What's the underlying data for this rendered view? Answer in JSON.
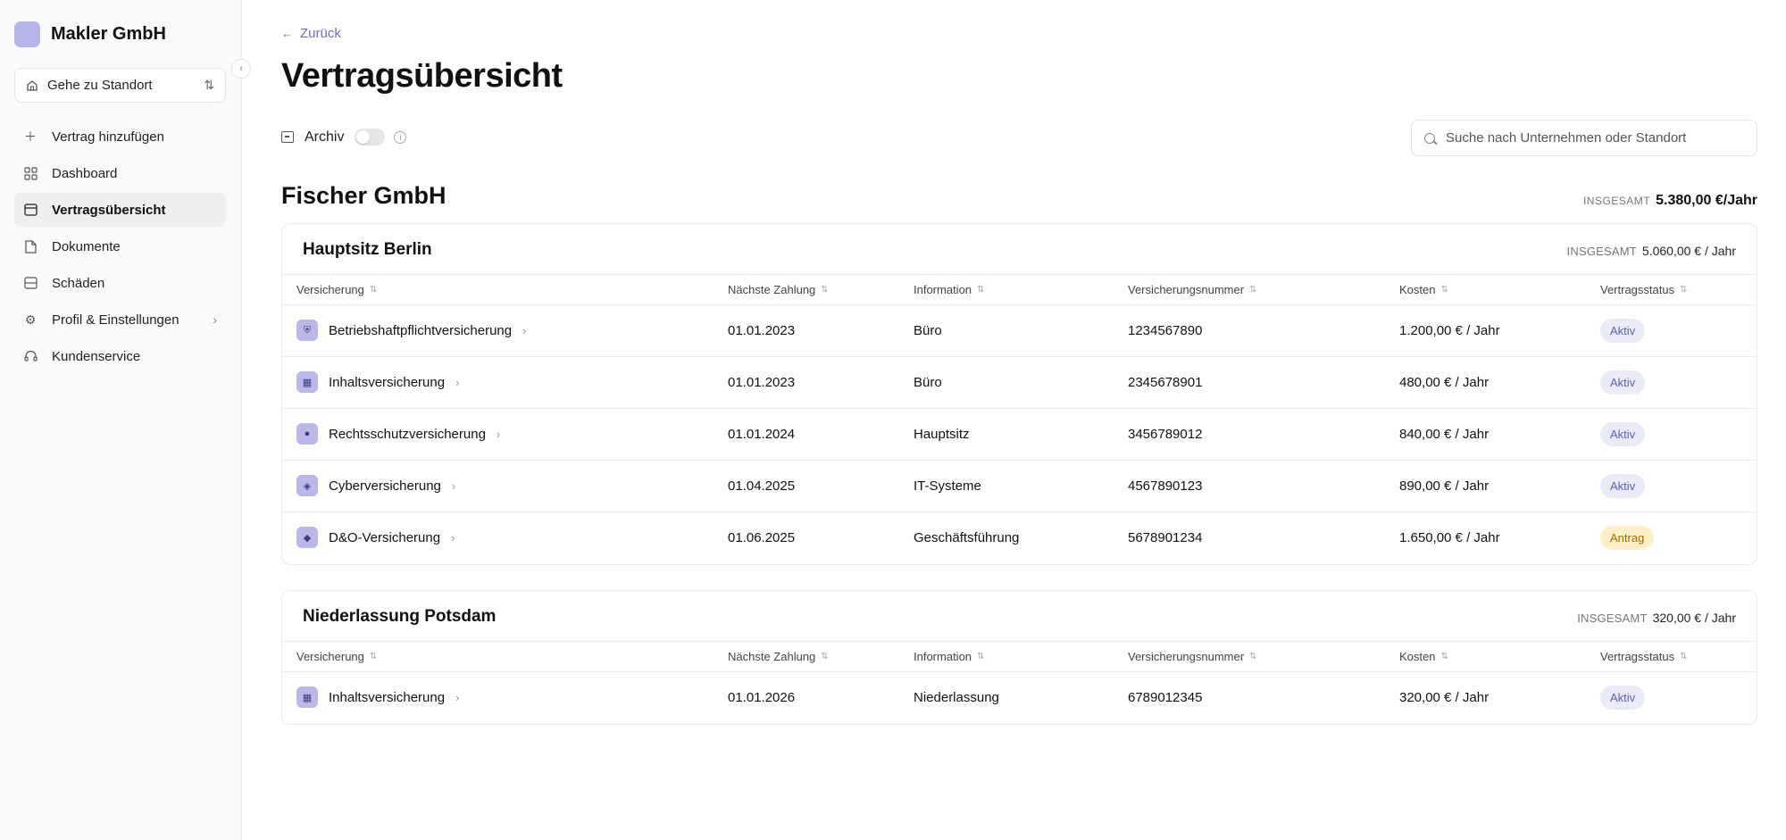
{
  "sidebar": {
    "brand": "Makler GmbH",
    "location_select": "Gehe zu Standort",
    "nav": [
      {
        "label": "Vertrag hinzufügen",
        "icon": "plus-icon"
      },
      {
        "label": "Dashboard",
        "icon": "grid-icon"
      },
      {
        "label": "Vertragsübersicht",
        "icon": "contract-icon",
        "active": true
      },
      {
        "label": "Dokumente",
        "icon": "document-icon"
      },
      {
        "label": "Schäden",
        "icon": "damage-icon"
      },
      {
        "label": "Profil & Einstellungen",
        "icon": "gear-icon",
        "has_chevron": true
      },
      {
        "label": "Kundenservice",
        "icon": "headset-icon"
      }
    ]
  },
  "header": {
    "back_label": "Zurück",
    "title": "Vertragsübersicht",
    "archive_label": "Archiv",
    "archive_on": false,
    "search_placeholder": "Suche nach Unternehmen oder Standort"
  },
  "company": {
    "name": "Fischer GmbH",
    "total_label": "INSGESAMT",
    "total_value": "5.380,00 €/Jahr"
  },
  "columns": [
    "Versicherung",
    "Nächste Zahlung",
    "Information",
    "Versicherungsnummer",
    "Kosten",
    "Vertragsstatus"
  ],
  "locations": [
    {
      "name": "Hauptsitz Berlin",
      "total_label": "INSGESAMT",
      "total_value": "5.060,00 € / Jahr",
      "rows": [
        {
          "insurance": "Betriebshaftpflichtversicherung",
          "icon": "shield-icon",
          "glyph": "⛨",
          "next_payment": "01.01.2023",
          "info": "Büro",
          "number": "1234567890",
          "cost": "1.200,00 € / Jahr",
          "status": "Aktiv"
        },
        {
          "insurance": "Inhaltsversicherung",
          "icon": "box-icon",
          "glyph": "▦",
          "next_payment": "01.01.2023",
          "info": "Büro",
          "number": "2345678901",
          "cost": "480,00 € / Jahr",
          "status": "Aktiv"
        },
        {
          "insurance": "Rechtsschutzversicherung",
          "icon": "scale-icon",
          "glyph": "●",
          "next_payment": "01.01.2024",
          "info": "Hauptsitz",
          "number": "3456789012",
          "cost": "840,00 € / Jahr",
          "status": "Aktiv"
        },
        {
          "insurance": "Cyberversicherung",
          "icon": "cyber-icon",
          "glyph": "◈",
          "next_payment": "01.04.2025",
          "info": "IT-Systeme",
          "number": "4567890123",
          "cost": "890,00 € / Jahr",
          "status": "Aktiv"
        },
        {
          "insurance": "D&O-Versicherung",
          "icon": "diamond-icon",
          "glyph": "◆",
          "next_payment": "01.06.2025",
          "info": "Geschäftsführung",
          "number": "5678901234",
          "cost": "1.650,00 € / Jahr",
          "status": "Antrag"
        }
      ]
    },
    {
      "name": "Niederlassung Potsdam",
      "total_label": "INSGESAMT",
      "total_value": "320,00 € / Jahr",
      "rows": [
        {
          "insurance": "Inhaltsversicherung",
          "icon": "box-icon",
          "glyph": "▦",
          "next_payment": "01.01.2026",
          "info": "Niederlassung",
          "number": "6789012345",
          "cost": "320,00 € / Jahr",
          "status": "Aktiv"
        }
      ]
    }
  ],
  "colors": {
    "accent": "#6f6cc4",
    "icon_bg": "#b9b8e6",
    "status_aktiv_bg": "#ebebf7",
    "status_antrag_bg": "#fdf0c8"
  }
}
